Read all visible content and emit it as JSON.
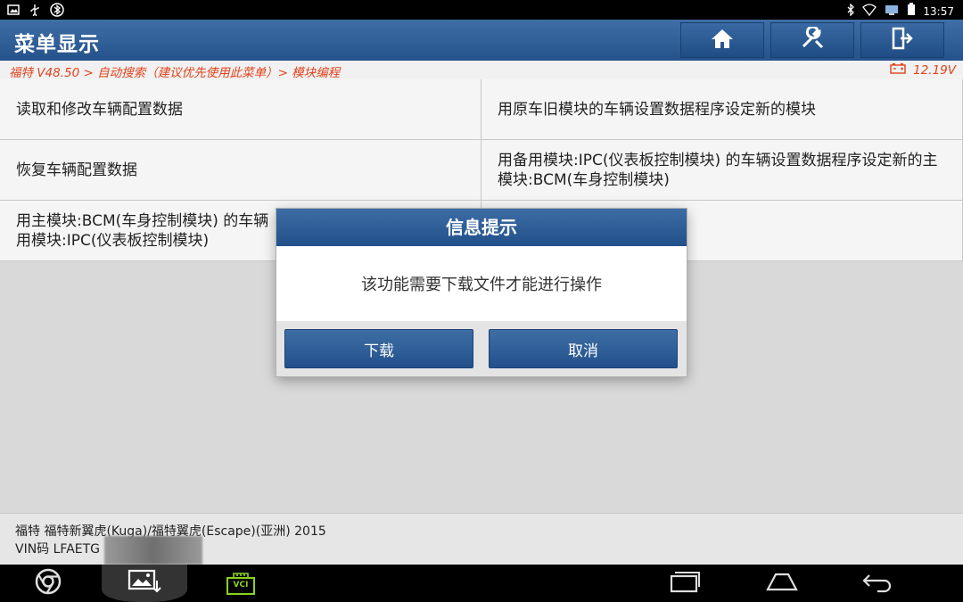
{
  "status_bar": {
    "time": "13:57"
  },
  "header": {
    "title": "菜单显示",
    "icons": [
      "home-icon",
      "diagnose-tool-icon",
      "exit-icon"
    ]
  },
  "breadcrumb": {
    "path": "福特 V48.50 > 自动搜索（建议优先使用此菜单）> 模块编程",
    "voltage": "12.19V"
  },
  "menu": {
    "items": [
      "读取和修改车辆配置数据",
      "用原车旧模块的车辆设置数据程序设定新的模块",
      "恢复车辆配置数据",
      "用备用模块:IPC(仪表板控制模块) 的车辆设置数据程序设定新的主模块:BCM(车身控制模块)",
      "用主模块:BCM(车身控制模块) 的车辆设置数据程序设定新的备用模块:IPC(仪表板控制模块)",
      ""
    ],
    "item5_visible": "用主模块:BCM(车身控制模块) 的车辆",
    "item5_line2": "用模块:IPC(仪表板控制模块)"
  },
  "vehicle": {
    "line1": "福特 福特新翼虎(Kuga)/福特翼虎(Escape)(亚洲) 2015",
    "vin": "VIN码 LFAETG"
  },
  "dialog": {
    "title": "信息提示",
    "message": "该功能需要下载文件才能进行操作",
    "ok_label": "下载",
    "cancel_label": "取消"
  },
  "nav": {
    "vci_label": "VCI"
  },
  "colors": {
    "header": "#2f5f99",
    "breadcrumb_text": "#e0421b",
    "vci": "#8bd11f"
  }
}
